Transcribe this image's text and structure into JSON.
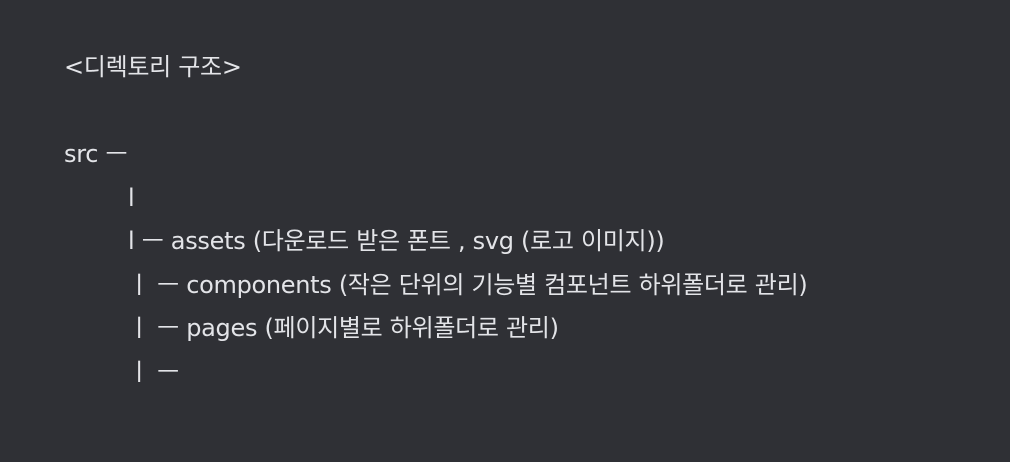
{
  "document": {
    "title": "<디렉토리 구조>",
    "tree_lines": [
      "src ㅡ",
      "l",
      "l ㅡ assets (다운로드 받은 폰트 , svg (로고 이미지))",
      "ㅣ ㅡ components (작은 단위의 기능별 컴포넌트 하위폴더로 관리)",
      "ㅣ ㅡ pages (페이지별로 하위폴더로 관리)",
      "ㅣ ㅡ"
    ]
  }
}
